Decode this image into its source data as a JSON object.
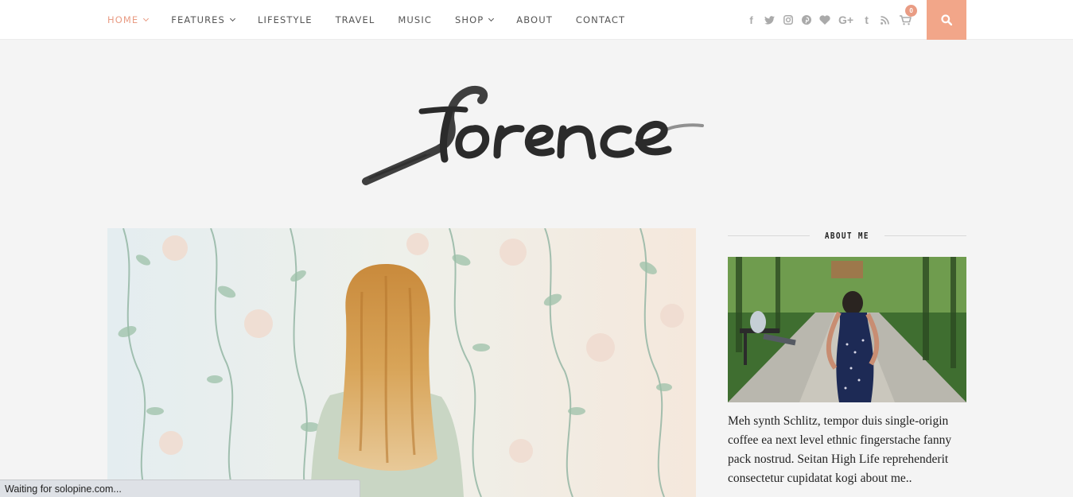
{
  "nav": {
    "items": [
      {
        "label": "HOME",
        "active": true,
        "dropdown": true
      },
      {
        "label": "FEATURES",
        "active": false,
        "dropdown": true
      },
      {
        "label": "LIFESTYLE",
        "active": false,
        "dropdown": false
      },
      {
        "label": "TRAVEL",
        "active": false,
        "dropdown": false
      },
      {
        "label": "MUSIC",
        "active": false,
        "dropdown": false
      },
      {
        "label": "SHOP",
        "active": false,
        "dropdown": true
      },
      {
        "label": "ABOUT",
        "active": false,
        "dropdown": false
      },
      {
        "label": "CONTACT",
        "active": false,
        "dropdown": false
      }
    ]
  },
  "social": {
    "icons": [
      "facebook-icon",
      "twitter-icon",
      "instagram-icon",
      "pinterest-icon",
      "bloglovin-heart-icon",
      "google-plus-icon",
      "tumblr-icon",
      "rss-icon"
    ],
    "google_plus_text": "G+",
    "tumblr_text": "t",
    "facebook_text": "f"
  },
  "cart": {
    "count": "0",
    "icon": "shopping-cart-icon"
  },
  "search": {
    "icon": "search-icon"
  },
  "logo": {
    "alt": "Florence"
  },
  "sidebar": {
    "about_title": "ABOUT ME",
    "about_text": "Meh synth Schlitz, tempor duis single-origin coffee ea next level ethnic fingerstache fanny pack nostrud. Seitan High Life reprehenderit consectetur cupidatat kogi about me.."
  },
  "status_bar": {
    "text": "Waiting for solopine.com..."
  },
  "colors": {
    "accent": "#e99c84",
    "search_bg": "#f2a689",
    "page_bg": "#f4f4f4"
  }
}
